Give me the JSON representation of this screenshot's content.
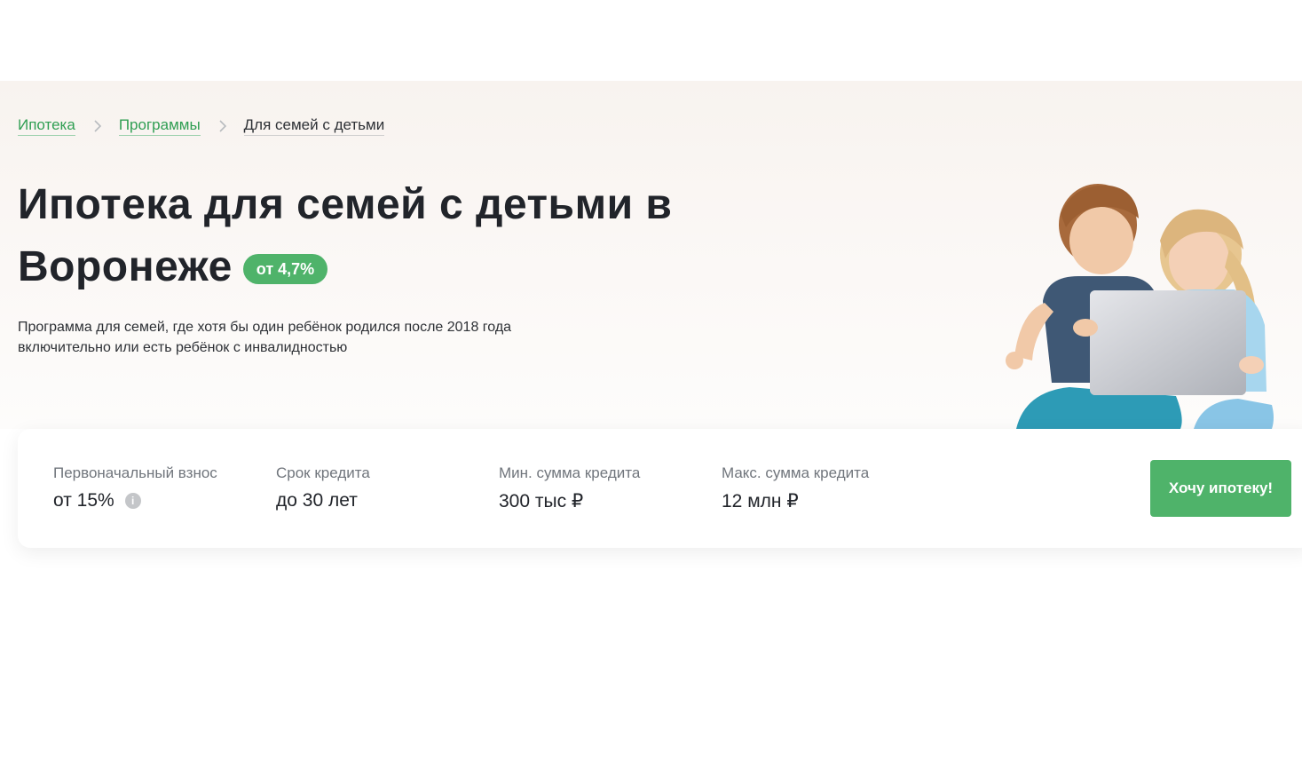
{
  "breadcrumb": {
    "items": [
      {
        "label": "Ипотека"
      },
      {
        "label": "Программы"
      },
      {
        "label": "Для семей с детьми"
      }
    ]
  },
  "hero": {
    "title_line1": "Ипотека для семей с детьми в",
    "title_line2": "Воронеже",
    "rate_badge": "от 4,7%",
    "subtitle_line1": "Программа для семей, где хотя бы один ребёнок родился после 2018 года",
    "subtitle_line2": "включительно или есть ребёнок с инвалидностью"
  },
  "params": [
    {
      "label": "Первоначальный взнос",
      "value": "от 15%"
    },
    {
      "label": "Срок кредита",
      "value": "до 30 лет"
    },
    {
      "label": "Мин. сумма кредита",
      "value": "300 тыс ₽"
    },
    {
      "label": "Макс. сумма кредита",
      "value": "12 млн ₽"
    }
  ],
  "cta": {
    "label": "Хочу ипотеку!"
  },
  "colors": {
    "accent": "#4fb36a",
    "link": "#2f9e52",
    "text": "#21242a",
    "muted": "#70757c"
  }
}
